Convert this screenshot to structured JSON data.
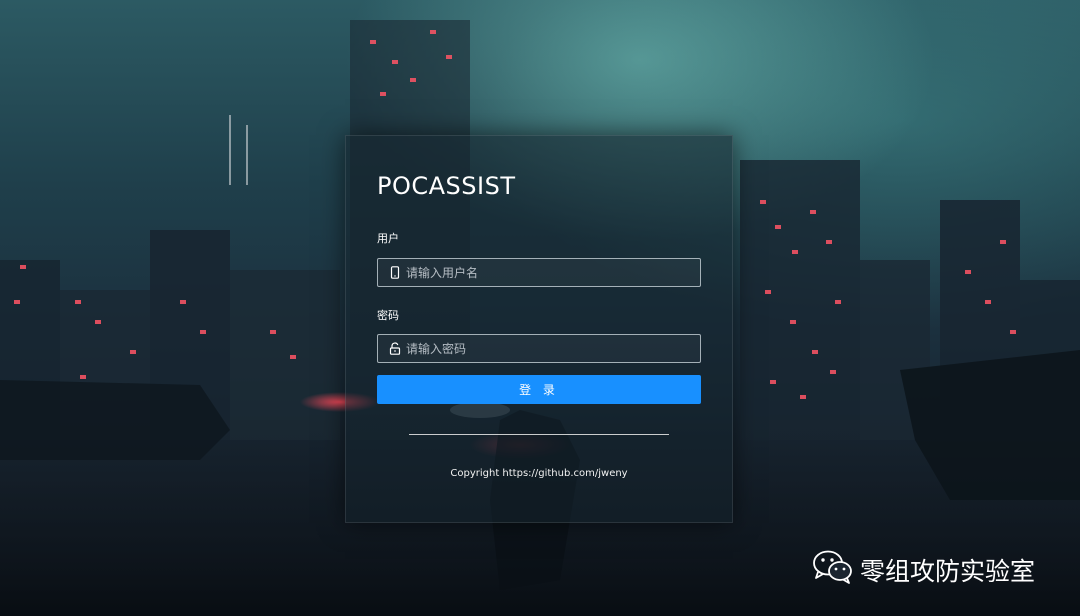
{
  "app": {
    "title": "POCASSIST"
  },
  "form": {
    "username_label": "用户",
    "username_placeholder": "请输入用户名",
    "username_value": "",
    "username_icon": "mobile-phone-icon",
    "password_label": "密码",
    "password_placeholder": "请输入密码",
    "password_value": "",
    "password_icon": "unlock-icon",
    "login_label": "登 录"
  },
  "footer": {
    "copyright": "Copyright https://github.com/jweny"
  },
  "watermark": {
    "text": "零组攻防实验室",
    "icon": "wechat-icon"
  },
  "colors": {
    "primary_button": "#1890ff",
    "background": "#1b2f3d",
    "text": "#ffffff"
  }
}
